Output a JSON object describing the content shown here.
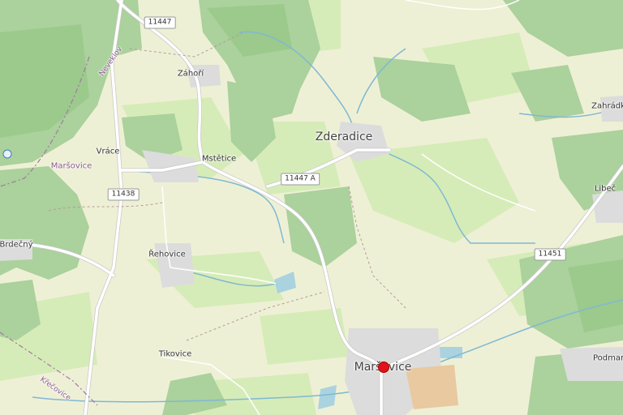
{
  "map": {
    "colors": {
      "background": "#eef0d5",
      "forest": "#abd19c",
      "forest_dark": "#9cc98c",
      "meadow": "#d6ecb8",
      "water": "#aad3df",
      "road": "#ffffff",
      "road_casing": "#c8c8c8",
      "settlement": "#dcdcdc",
      "marker": "#e0141b"
    },
    "place_labels": {
      "zahori": "Záhoří",
      "vrace": "Vráce",
      "marsovice_region": "Maršovice",
      "mstetice": "Mstětice",
      "zderadice": "Zderadice",
      "zahradka": "Zahrádk",
      "libec": "Libeč",
      "brdecny": "Brdečný",
      "rehovice": "Řehovice",
      "tikovice": "Tikovice",
      "marsovice": "Maršovice",
      "podmar": "Podmar",
      "neveklov": "Neveklov",
      "krecovice": "Křečovice"
    },
    "road_refs": {
      "r11447": "11447",
      "r11447a": "11447 A",
      "r11438": "11438",
      "r11451": "11451"
    },
    "marker_name": "location-marker"
  }
}
